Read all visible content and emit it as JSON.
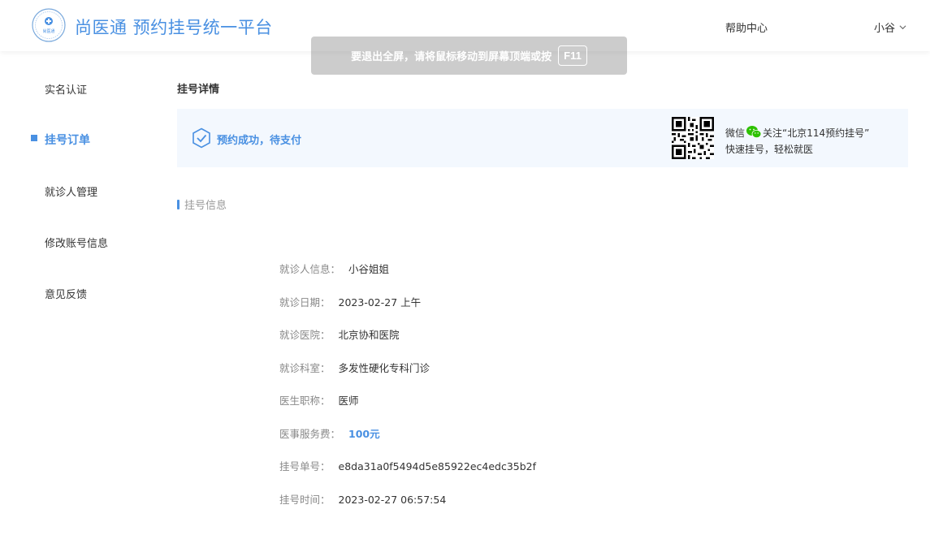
{
  "header": {
    "logo_text": "尚医通",
    "app_title": "尚医通 预约挂号统一平台",
    "help_label": "帮助中心",
    "user_name": "小谷"
  },
  "toast": {
    "message": "要退出全屏，请将鼠标移动到屏幕顶端或按",
    "key": "F11"
  },
  "sidebar": {
    "items": [
      {
        "label": "实名认证"
      },
      {
        "label": "挂号订单"
      },
      {
        "label": "就诊人管理"
      },
      {
        "label": "修改账号信息"
      },
      {
        "label": "意见反馈"
      }
    ],
    "active_index": 1
  },
  "main": {
    "page_title": "挂号详情",
    "status_text": "预约成功，待支付",
    "promo": {
      "line1_prefix": "微信",
      "line1_suffix": "关注“北京114预约挂号”",
      "line2": "快速挂号，轻松就医"
    },
    "section_title": "挂号信息",
    "info": [
      {
        "label": "就诊人信息：",
        "value": "小谷姐姐"
      },
      {
        "label": "就诊日期：",
        "value": "2023-02-27 上午"
      },
      {
        "label": "就诊医院：",
        "value": "北京协和医院"
      },
      {
        "label": "就诊科室：",
        "value": "多发性硬化专科门诊"
      },
      {
        "label": "医生职称：",
        "value": "医师"
      },
      {
        "label": "医事服务费：",
        "value": "100元"
      },
      {
        "label": "挂号单号：",
        "value": "e8da31a0f5494d5e85922ec4edc35b2f"
      },
      {
        "label": "挂号时间：",
        "value": "2023-02-27 06:57:54"
      }
    ]
  },
  "colors": {
    "accent": "#4990e2",
    "status_bg": "#f3f8fe",
    "wechat_green": "#2dc100"
  },
  "icons": {
    "logo": "hospital-logo-icon",
    "status": "shield-check-icon",
    "qr": "qr-code-icon",
    "wechat": "wechat-icon",
    "chevron": "chevron-down-icon"
  }
}
